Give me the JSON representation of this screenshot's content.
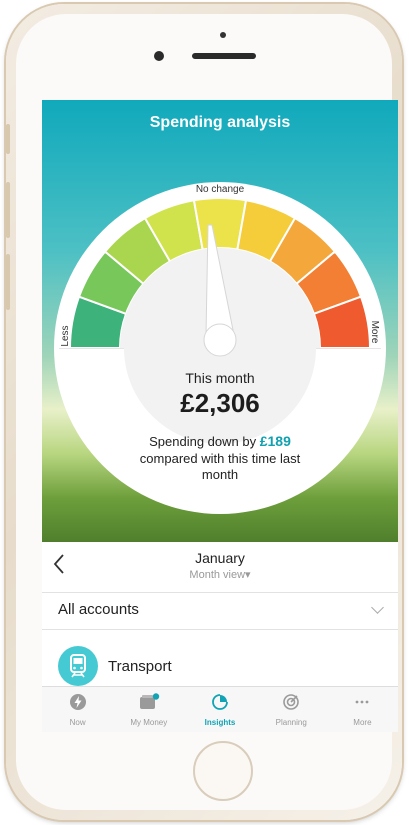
{
  "header": {
    "title": "Spending analysis"
  },
  "gauge": {
    "label_left": "Less",
    "label_top": "No change",
    "label_right": "More",
    "segment_colors": [
      "#3eb27b",
      "#78c75a",
      "#a9d64e",
      "#d1e34c",
      "#ece34a",
      "#f5cc3a",
      "#f4a73a",
      "#f27f33",
      "#ef5a2e"
    ]
  },
  "summary": {
    "label": "This month",
    "amount": "£2,306",
    "trend_prefix": "Spending down by",
    "trend_value": "£189",
    "compare_line1": "compared with this time last",
    "compare_line2": "month"
  },
  "period": {
    "month": "January",
    "view": "Month view▾",
    "back_icon": "chevron-left-icon"
  },
  "accounts": {
    "label": "All accounts",
    "icon": "chevron-down-icon"
  },
  "category": {
    "label": "Transport",
    "icon": "train-icon",
    "color": "#45cad3"
  },
  "tabs": [
    {
      "label": "Now",
      "icon": "lightning-icon"
    },
    {
      "label": "My Money",
      "icon": "wallet-icon"
    },
    {
      "label": "Insights",
      "icon": "insights-icon",
      "active": true
    },
    {
      "label": "Planning",
      "icon": "target-icon"
    },
    {
      "label": "More",
      "icon": "more-icon"
    }
  ],
  "colors": {
    "accent": "#12a3b5",
    "highlight": "#10a0b0"
  }
}
